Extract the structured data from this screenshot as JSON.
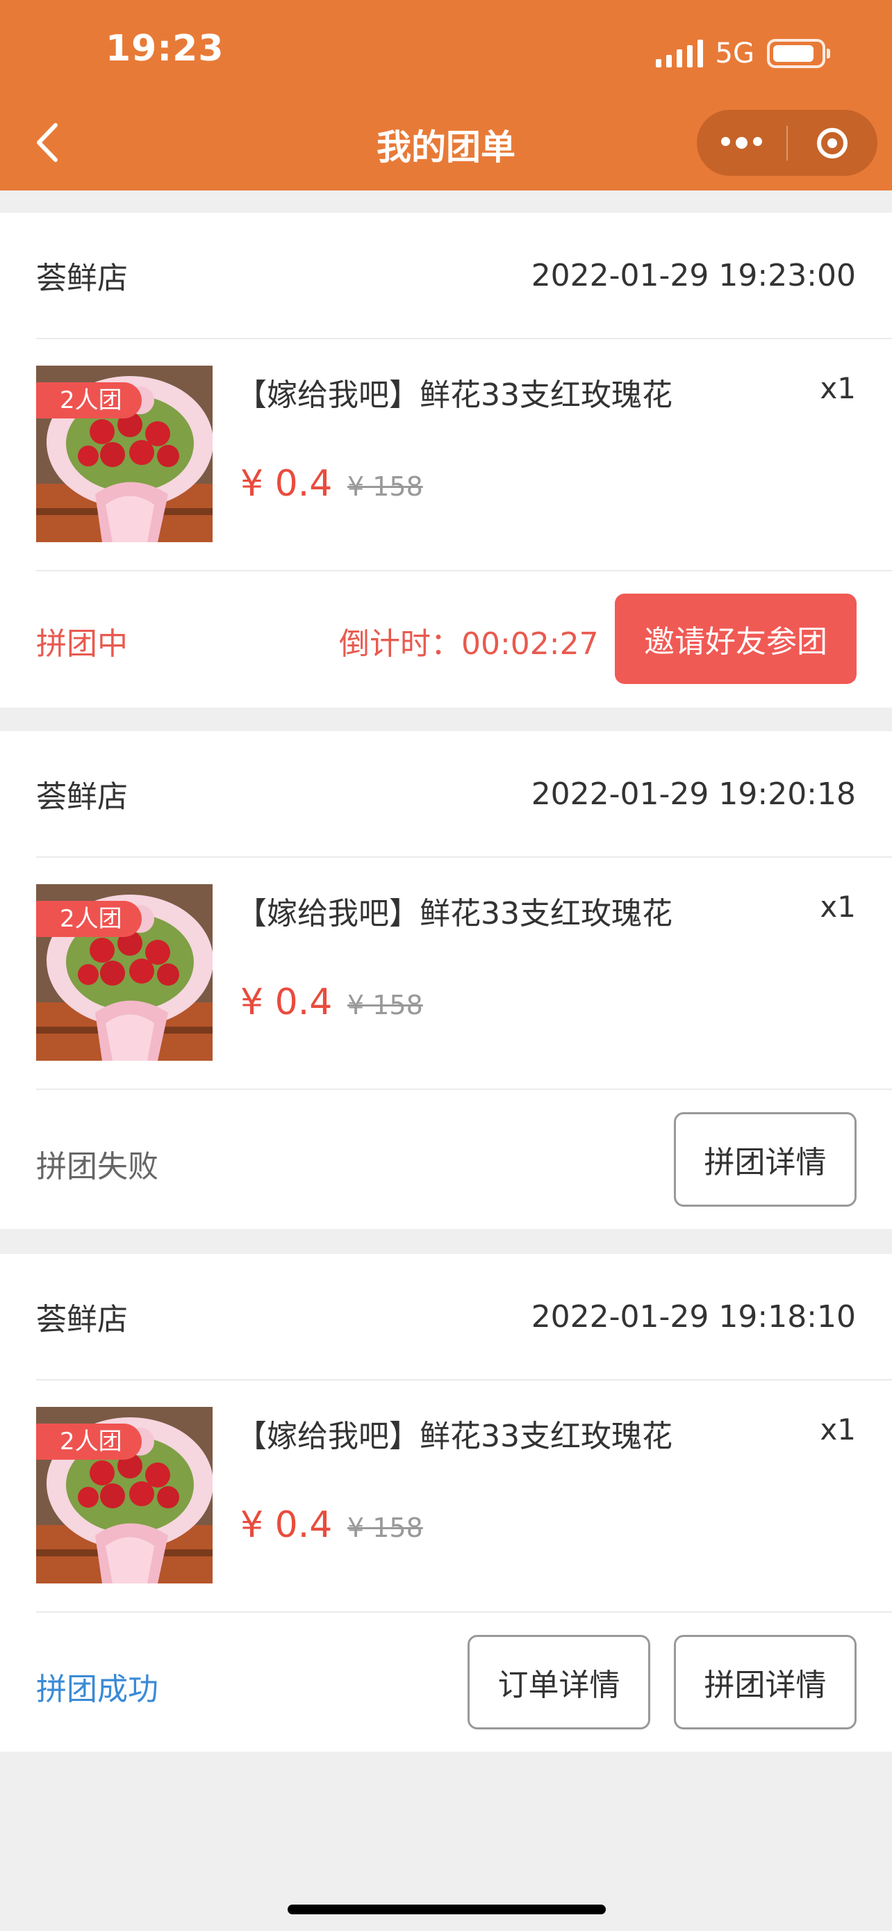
{
  "status_bar": {
    "time": "19:23",
    "network": "5G"
  },
  "header": {
    "title": "我的团单"
  },
  "orders": [
    {
      "store": "荟鲜店",
      "time": "2022-01-29 19:23:00",
      "tag": "2人团",
      "product": "【嫁给我吧】鲜花33支红玫瑰花",
      "qty": "x1",
      "price": "¥ 0.4",
      "original_price": "¥ 158",
      "status": "拼团中",
      "countdown": "倒计时：00:02:27",
      "action": "邀请好友参团"
    },
    {
      "store": "荟鲜店",
      "time": "2022-01-29 19:20:18",
      "tag": "2人团",
      "product": "【嫁给我吧】鲜花33支红玫瑰花",
      "qty": "x1",
      "price": "¥ 0.4",
      "original_price": "¥ 158",
      "status": "拼团失败",
      "action": "拼团详情"
    },
    {
      "store": "荟鲜店",
      "time": "2022-01-29 19:18:10",
      "tag": "2人团",
      "product": "【嫁给我吧】鲜花33支红玫瑰花",
      "qty": "x1",
      "price": "¥ 0.4",
      "original_price": "¥ 158",
      "status": "拼团成功",
      "action_secondary": "订单详情",
      "action": "拼团详情"
    }
  ],
  "colors": {
    "header": "#e87a37",
    "accent_red": "#e84c3d",
    "status_pending": "#e85a4f",
    "status_failed": "#666666",
    "status_success": "#3a8ad6"
  }
}
